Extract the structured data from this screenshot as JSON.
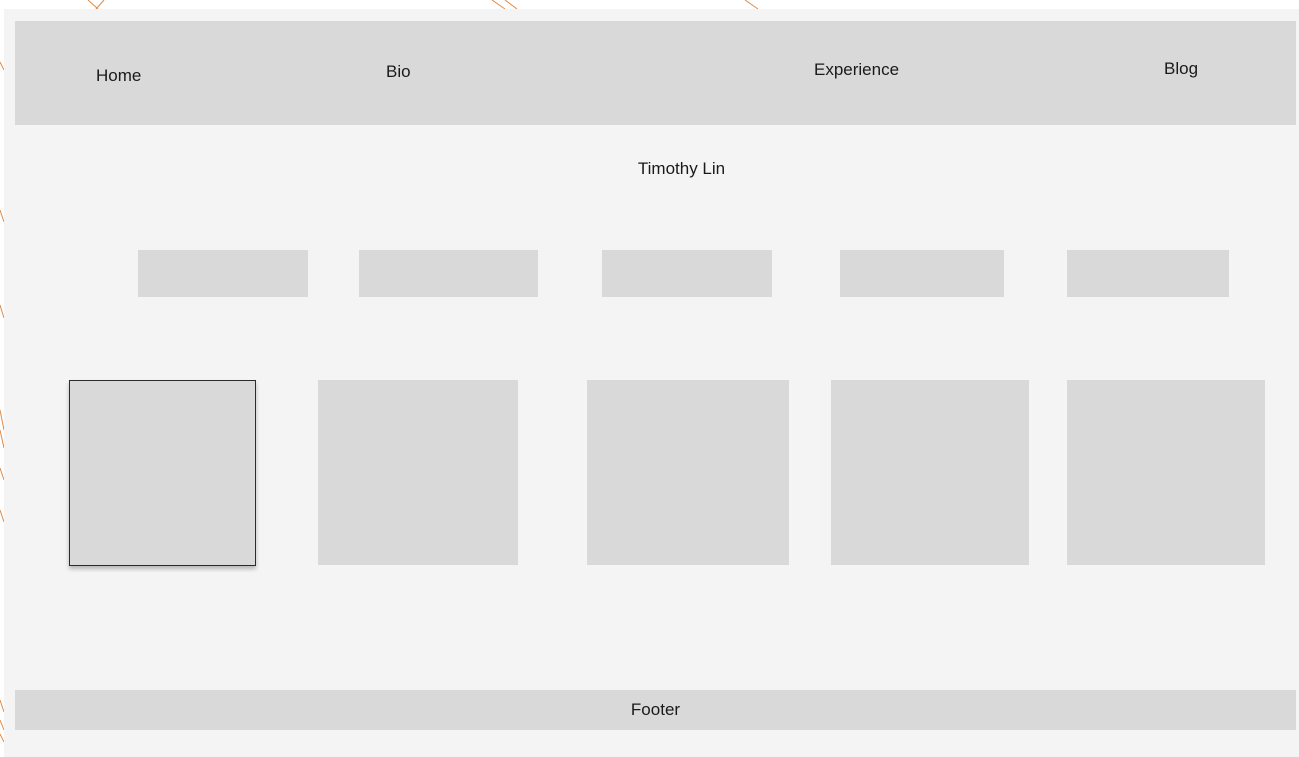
{
  "nav": {
    "home": "Home",
    "bio": "Bio",
    "experience": "Experience",
    "blog": "Blog"
  },
  "hero": {
    "title": "Timothy Lin"
  },
  "footer": {
    "label": "Footer"
  },
  "colors": {
    "canvas": "#ffffff",
    "frame": "#f4f4f4",
    "placeholder": "#d9d9d9",
    "decoration_lines": "#e08a45"
  }
}
